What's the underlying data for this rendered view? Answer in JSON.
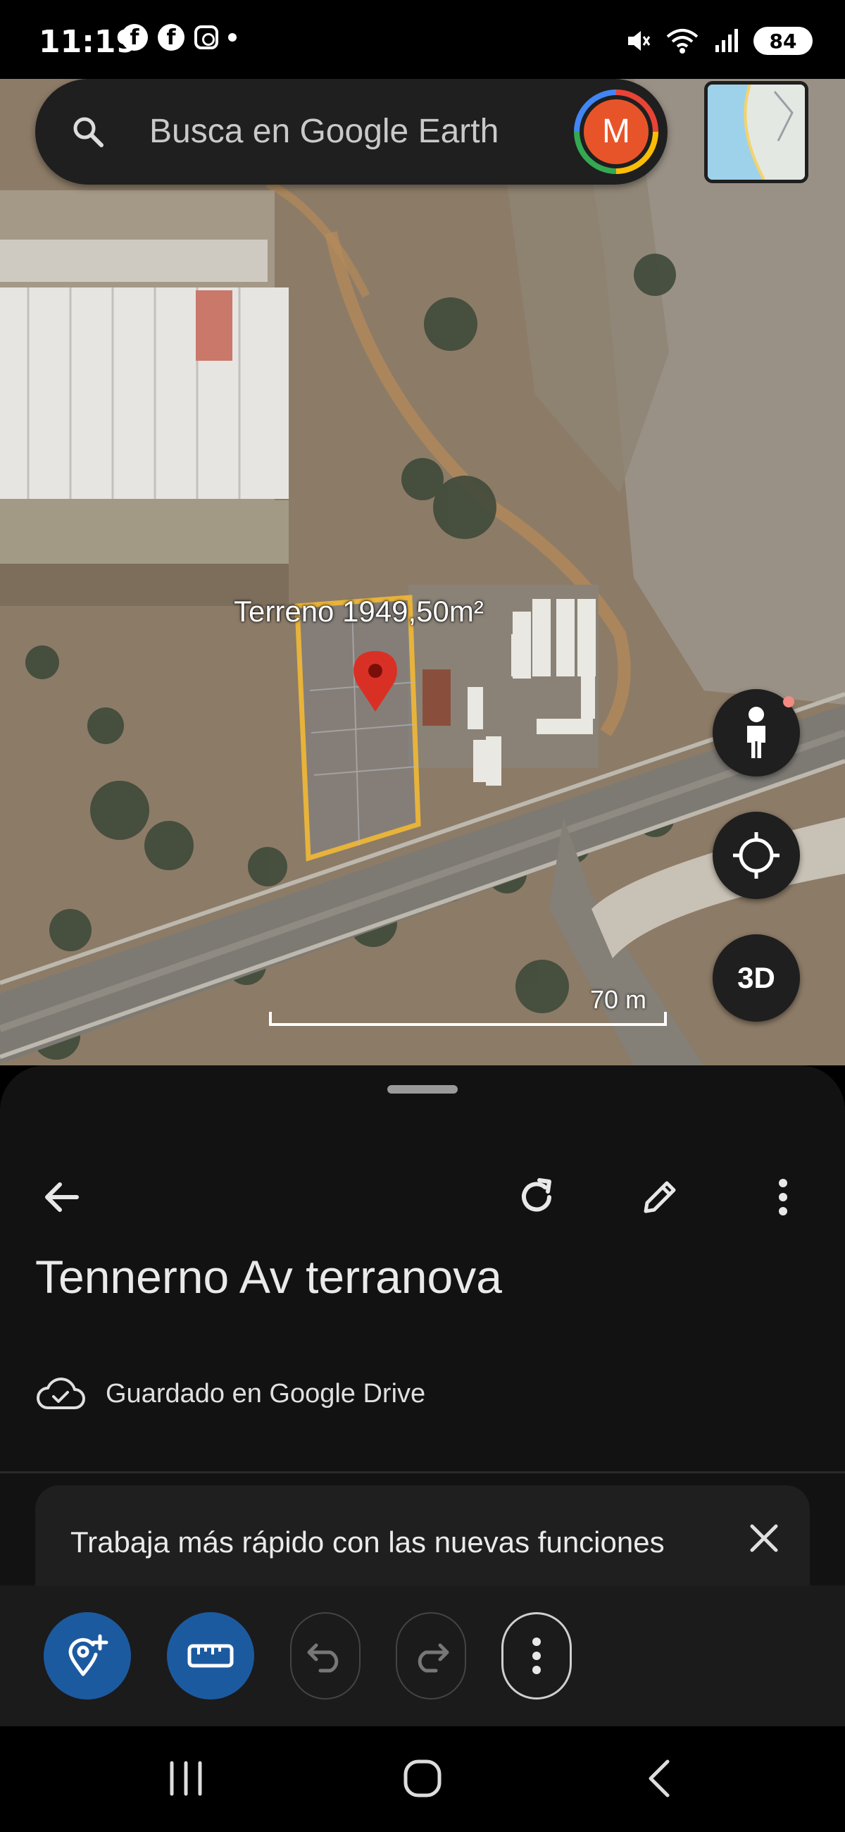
{
  "status_bar": {
    "time": "11:19",
    "battery": "84",
    "icons_left": [
      "facebook-icon",
      "facebook-icon",
      "instagram-icon",
      "notification-dot"
    ],
    "icons_right": [
      "mute-icon",
      "wifi-icon",
      "signal-icon",
      "battery-icon"
    ]
  },
  "search": {
    "placeholder": "Busca en Google Earth",
    "avatar_letter": "M"
  },
  "map": {
    "feature_label": "Terreno 1949,50m²",
    "scale_label": "70 m",
    "buttons": [
      "pegman-icon",
      "my-location-icon",
      "3D"
    ],
    "three_d_label": "3D"
  },
  "sheet": {
    "title": "Tennerno Av terranova",
    "saved_status": "Guardado en Google Drive",
    "promo_text": "Trabaja más rápido con las nuevas funciones"
  },
  "toolbar": {
    "buttons": [
      "add-placemark-icon",
      "ruler-icon",
      "undo-icon",
      "redo-icon",
      "more-vert-icon"
    ]
  },
  "colors": {
    "accent_blue": "#1c5aa0",
    "avatar": "#e8542a",
    "polygon_outline": "#e8b33a",
    "pin": "#d93025"
  }
}
